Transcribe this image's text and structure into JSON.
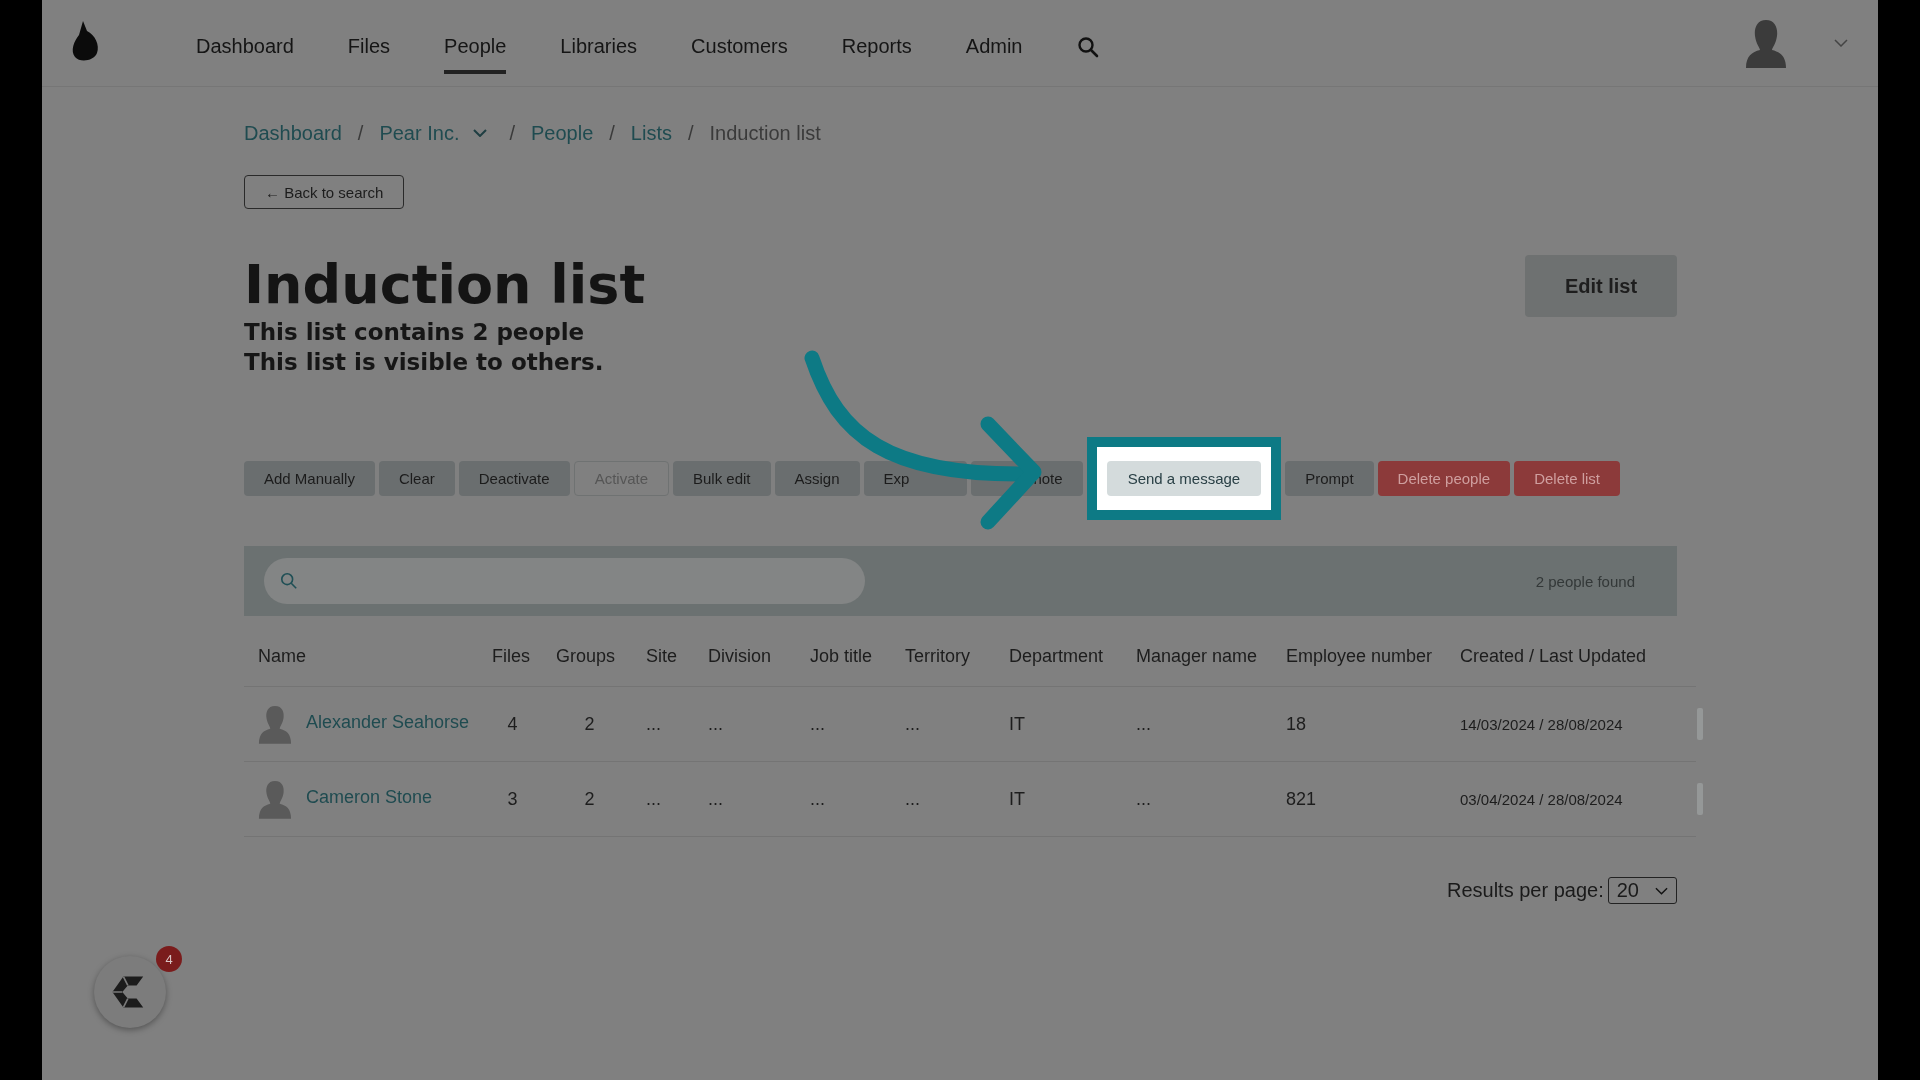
{
  "nav": {
    "items": [
      {
        "label": "Dashboard",
        "selected": false
      },
      {
        "label": "Files",
        "selected": false
      },
      {
        "label": "People",
        "selected": true
      },
      {
        "label": "Libraries",
        "selected": false
      },
      {
        "label": "Customers",
        "selected": false
      },
      {
        "label": "Reports",
        "selected": false
      },
      {
        "label": "Admin",
        "selected": false
      }
    ]
  },
  "breadcrumb_separator": "/",
  "breadcrumb": [
    {
      "label": "Dashboard",
      "kind": "link"
    },
    {
      "label": "Pear Inc.",
      "kind": "dropdown"
    },
    {
      "label": "People",
      "kind": "link"
    },
    {
      "label": "Lists",
      "kind": "link"
    },
    {
      "label": "Induction list",
      "kind": "current"
    }
  ],
  "back_button": "← Back to search",
  "title": "Induction list",
  "summary": [
    "This list contains 2 people",
    "This list is visible to others."
  ],
  "edit_button": "Edit list",
  "actions": [
    {
      "label": "Add Manually",
      "kind": "normal"
    },
    {
      "label": "Clear",
      "kind": "normal"
    },
    {
      "label": "Deactivate",
      "kind": "normal"
    },
    {
      "label": "Activate",
      "kind": "disabled"
    },
    {
      "label": "Bulk edit",
      "kind": "normal"
    },
    {
      "label": "Assign",
      "kind": "normal"
    },
    {
      "label": "Exp",
      "kind": "covered-end"
    },
    {
      "label": "note",
      "kind": "covered-start"
    },
    {
      "label": "Send a message",
      "kind": "highlighted"
    },
    {
      "label": "Prompt",
      "kind": "normal"
    },
    {
      "label": "Delete people",
      "kind": "danger"
    },
    {
      "label": "Delete list",
      "kind": "danger"
    }
  ],
  "search": {
    "result_count": "2 people found"
  },
  "table": {
    "columns": [
      "Name",
      "Files",
      "Groups",
      "Site",
      "Division",
      "Job title",
      "Territory",
      "Department",
      "Manager name",
      "Employee number",
      "Created / Last Updated"
    ],
    "rows": [
      [
        "Alexander Seahorse",
        "4",
        "2",
        "...",
        "...",
        "...",
        "...",
        "IT",
        "...",
        "18",
        "14/03/2024 / 28/08/2024"
      ],
      [
        "Cameron Stone",
        "3",
        "2",
        "...",
        "...",
        "...",
        "...",
        "IT",
        "...",
        "821",
        "03/04/2024 / 28/08/2024"
      ]
    ]
  },
  "pagination": {
    "label": "Results per page:",
    "value": "20"
  },
  "chat": {
    "badge": "4"
  }
}
